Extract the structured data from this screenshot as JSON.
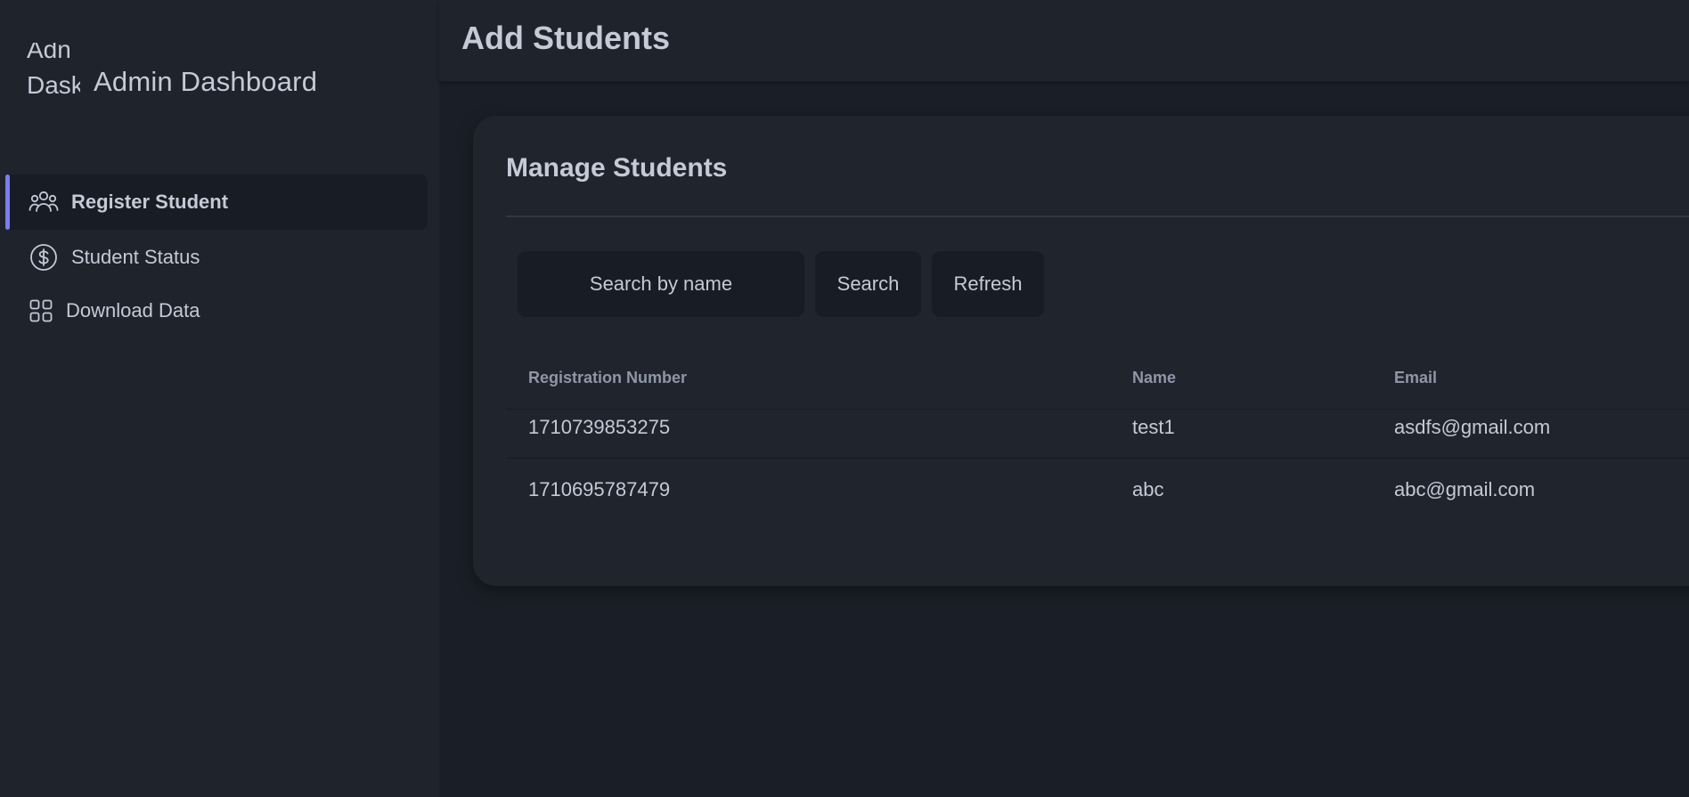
{
  "sidebar": {
    "logo_alt_lines": [
      "Adn",
      "Dask"
    ],
    "brand_title": "Admin Dashboard",
    "items": [
      {
        "label": "Register Student",
        "icon": "users-icon",
        "active": true
      },
      {
        "label": "Student Status",
        "icon": "dollar-circle-icon",
        "active": false
      },
      {
        "label": "Download Data",
        "icon": "grid-icon",
        "active": false
      }
    ]
  },
  "header": {
    "title": "Add Students"
  },
  "main": {
    "card_title": "Manage Students",
    "search": {
      "placeholder": "Search by name",
      "value": ""
    },
    "buttons": {
      "search_label": "Search",
      "refresh_label": "Refresh"
    },
    "table": {
      "columns": [
        "Registration Number",
        "Name",
        "Email"
      ],
      "rows": [
        [
          "1710739853275",
          "test1",
          "asdfs@gmail.com"
        ],
        [
          "1710695787479",
          "abc",
          "abc@gmail.com"
        ]
      ]
    }
  },
  "colors": {
    "accent": "#7c7cf2",
    "sidebar_bg": "#1e232c",
    "page_bg": "#1a1e26",
    "card_bg": "#1f242d",
    "text": "#c4cad6",
    "muted_text": "#8f97a7"
  }
}
